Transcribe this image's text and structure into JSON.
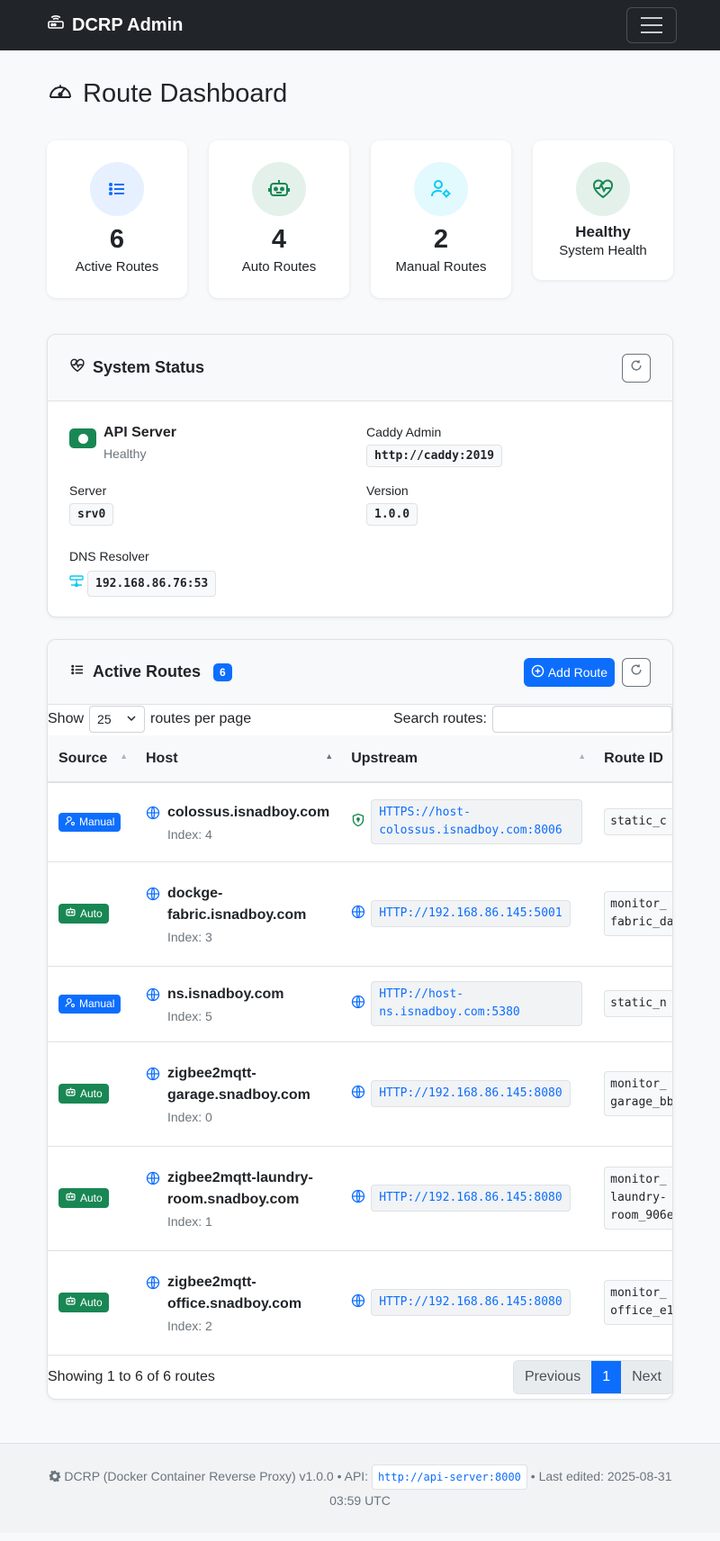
{
  "navbar": {
    "brand": "DCRP Admin",
    "brand_icon": "router-icon",
    "menu_icon": "hamburger-icon"
  },
  "page": {
    "title": "Route Dashboard",
    "title_icon": "speedometer-icon"
  },
  "stats": [
    {
      "value": "6",
      "label": "Active Routes",
      "icon": "list-icon",
      "color": "#0d6efd"
    },
    {
      "value": "4",
      "label": "Auto Routes",
      "icon": "robot-icon",
      "color": "#198754"
    },
    {
      "value": "2",
      "label": "Manual Routes",
      "icon": "user-gear-icon",
      "color": "#0dcaf0"
    },
    {
      "value": "Healthy",
      "label": "System Health",
      "icon": "heart-pulse-icon",
      "color": "#198754"
    }
  ],
  "system_status": {
    "title": "System Status",
    "api_server": {
      "name": "API Server",
      "status": "Healthy"
    },
    "caddy_admin": {
      "label": "Caddy Admin",
      "value": "http://caddy:2019"
    },
    "server": {
      "label": "Server",
      "value": "srv0"
    },
    "version": {
      "label": "Version",
      "value": "1.0.0"
    },
    "dns_resolver": {
      "label": "DNS Resolver",
      "value": "192.168.86.76:53"
    }
  },
  "routes": {
    "title": "Active Routes",
    "count": "6",
    "add_label": "Add Route",
    "show_label": "Show",
    "per_page": "25",
    "per_page_label": "routes per page",
    "search_label": "Search routes:",
    "search_placeholder": "",
    "columns": [
      "Source",
      "Host",
      "Upstream",
      "Route ID"
    ],
    "rows": [
      {
        "source": "Manual",
        "host": "colossus.isnadboy.com",
        "index": "Index: 4",
        "upstream": "HTTPS://host-colossus.isnadboy.com:8006",
        "secure": true,
        "route_id": "static_c"
      },
      {
        "source": "Auto",
        "host": "dockge-fabric.isnadboy.com",
        "index": "Index: 3",
        "upstream": "HTTP://192.168.86.145:5001",
        "secure": false,
        "route_id": "monitor_\nfabric_da"
      },
      {
        "source": "Manual",
        "host": "ns.isnadboy.com",
        "index": "Index: 5",
        "upstream": "HTTP://host-ns.isnadboy.com:5380",
        "secure": false,
        "route_id": "static_n"
      },
      {
        "source": "Auto",
        "host": "zigbee2mqtt-garage.snadboy.com",
        "index": "Index: 0",
        "upstream": "HTTP://192.168.86.145:8080",
        "secure": false,
        "route_id": "monitor_\ngarage_bb"
      },
      {
        "source": "Auto",
        "host": "zigbee2mqtt-laundry-room.snadboy.com",
        "index": "Index: 1",
        "upstream": "HTTP://192.168.86.145:8080",
        "secure": false,
        "route_id": "monitor_\nlaundry-\nroom_906e"
      },
      {
        "source": "Auto",
        "host": "zigbee2mqtt-office.snadboy.com",
        "index": "Index: 2",
        "upstream": "HTTP://192.168.86.145:8080",
        "secure": false,
        "route_id": "monitor_\noffice_e1"
      }
    ],
    "showing": "Showing 1 to 6 of 6 routes",
    "pager": {
      "previous": "Previous",
      "current": "1",
      "next": "Next"
    }
  },
  "footer": {
    "text_prefix": "DCRP (Docker Container Reverse Proxy) v1.0.0 • API:",
    "api_url": "http://api-server:8000",
    "text_suffix": "• Last edited: 2025-08-31 03:59 UTC"
  }
}
